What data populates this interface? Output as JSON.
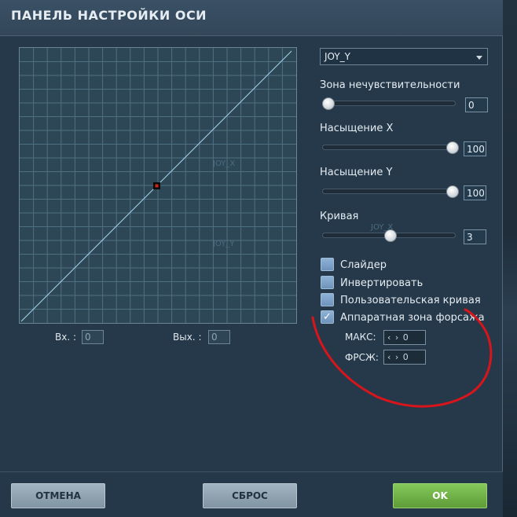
{
  "window": {
    "title": "ПАНЕЛЬ НАСТРОЙКИ ОСИ"
  },
  "graph": {
    "ghost_labels": [
      "JOY_X",
      "JOY_Y"
    ],
    "input_label": "Вх. :",
    "input_value": "0",
    "output_label": "Вых. :",
    "output_value": "0",
    "point_color": "#d0241c"
  },
  "axis_select": {
    "selected": "JOY_Y"
  },
  "sliders": [
    {
      "label": "Зона нечувствительности",
      "value": "0",
      "level": 0.0
    },
    {
      "label": "Насыщение X",
      "value": "100",
      "level": 1.0
    },
    {
      "label": "Насыщение Y",
      "value": "100",
      "level": 1.0
    },
    {
      "label": "Кривая",
      "value": "3",
      "level": 0.5,
      "ghost": "JOY_X"
    }
  ],
  "checkboxes": [
    {
      "label": "Слайдер",
      "checked": false
    },
    {
      "label": "Инвертировать",
      "checked": false
    },
    {
      "label": "Пользовательская кривая",
      "checked": false
    },
    {
      "label": "Аппаратная зона форсажа",
      "checked": true
    }
  ],
  "afterburner": {
    "max_label": "МАКС:",
    "max_value": "0",
    "frsg_label": "ФРСЖ:",
    "frsg_value": "0",
    "spin_arrows": "‹ ›"
  },
  "buttons": {
    "cancel": "ОТМЕНА",
    "reset": "СБРОС",
    "ok": "OK"
  },
  "colors": {
    "annotation": "#d8151b",
    "accent_green": "#6fb044",
    "curve": "#a9d6ef"
  }
}
